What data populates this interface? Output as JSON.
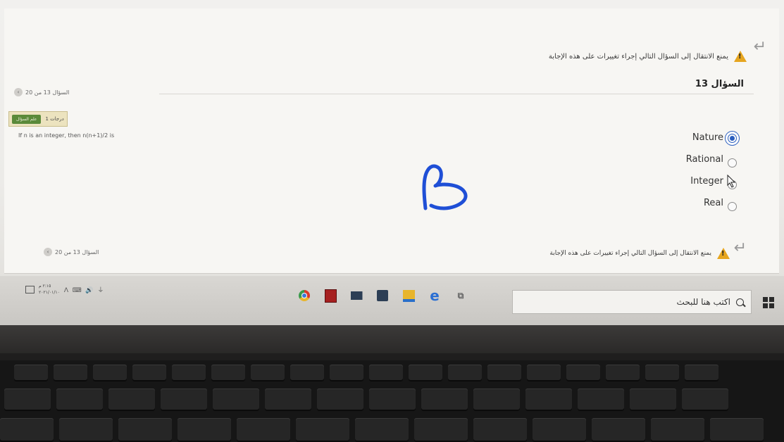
{
  "quiz": {
    "warning_text_line1": "يمنع الانتقال إلى السؤال التالي إجراء تغييرات على هذه الإجابة",
    "warning_text_line2": "",
    "question_title": "السؤال 13",
    "nav_label_top": "السؤال 13 من 20",
    "nav_label_bottom": "السؤال 13 من 20",
    "grade_text": "1 درجات",
    "flag_button": "علم السؤال",
    "question_text": "If n is an integer, then n(n+1)/2 is",
    "options": [
      {
        "label": "Nature",
        "selected": true
      },
      {
        "label": "Rational",
        "selected": false
      },
      {
        "label": "Integer",
        "selected": false
      },
      {
        "label": "Real",
        "selected": false
      }
    ],
    "warning_bottom": "يمنع الانتقال إلى السؤال التالي إجراء تغييرات على هذه الإجابة"
  },
  "taskbar": {
    "search_placeholder": "اكتب هنا للبحث",
    "clock_time": "٢:١٥ م",
    "clock_date": "٢٠٢١/٠١/١٠",
    "icons": [
      "chrome-icon",
      "app-icon",
      "mail-icon",
      "store-icon",
      "explorer-icon",
      "edge-icon",
      "taskview-icon"
    ]
  },
  "colors": {
    "accent": "#2b5fbf",
    "warning": "#e6a51f",
    "flag_button": "#5a8a3a"
  }
}
